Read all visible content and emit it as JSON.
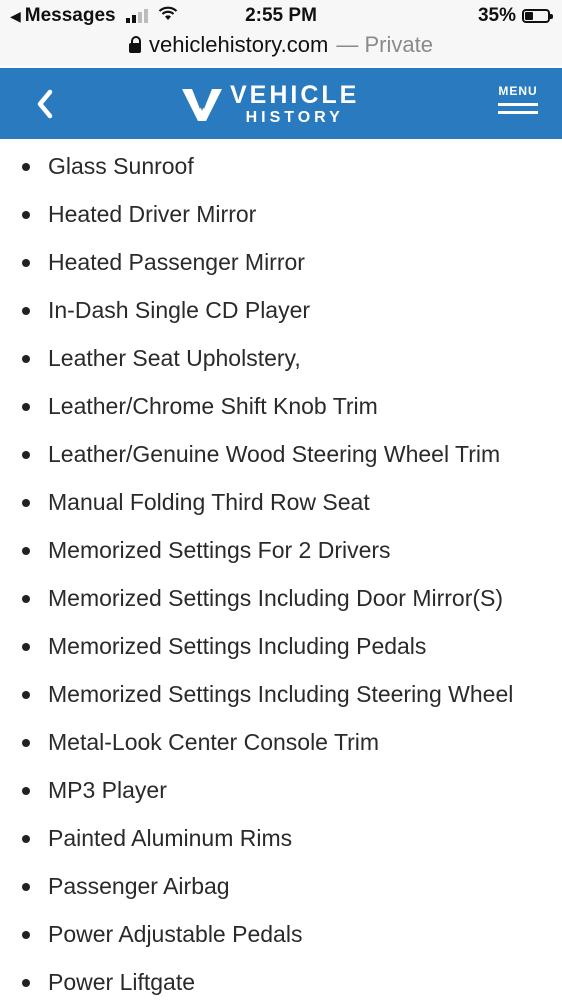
{
  "status_bar": {
    "back_app": "Messages",
    "time": "2:55 PM",
    "battery": "35%",
    "battery_level": 0.35
  },
  "url_bar": {
    "domain": "vehiclehistory.com",
    "private_label": "— Private"
  },
  "header": {
    "logo_line1": "VEHICLE",
    "logo_line2": "HISTORY",
    "menu_label": "MENU",
    "brand_color": "#2a7ac0"
  },
  "features": [
    "Glass Sunroof",
    "Heated Driver Mirror",
    "Heated Passenger Mirror",
    "In-Dash Single CD Player",
    "Leather Seat Upholstery,",
    "Leather/Chrome Shift Knob Trim",
    "Leather/Genuine Wood Steering Wheel Trim",
    "Manual Folding Third Row Seat",
    "Memorized Settings For 2 Drivers",
    "Memorized Settings Including Door Mirror(S)",
    "Memorized Settings Including Pedals",
    "Memorized Settings Including Steering Wheel",
    "Metal-Look Center Console Trim",
    "MP3 Player",
    "Painted Aluminum Rims",
    "Passenger Airbag",
    "Power Adjustable Pedals",
    "Power Liftgate"
  ]
}
